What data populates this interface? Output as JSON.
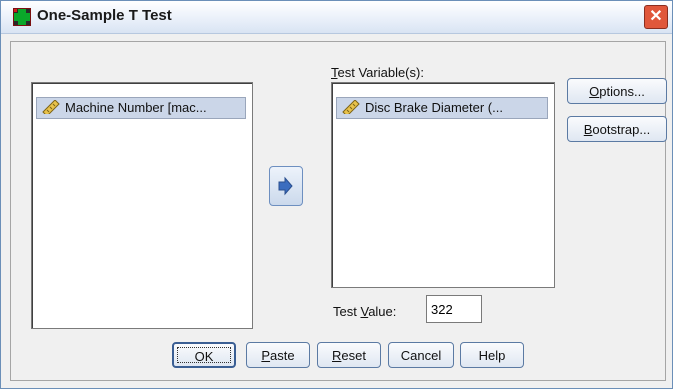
{
  "window": {
    "title": "One-Sample T Test",
    "close_glyph": "✕"
  },
  "source_list": {
    "items": [
      {
        "label": "Machine Number [mac...",
        "icon": "ruler-icon"
      }
    ]
  },
  "move_button": {
    "icon": "arrow-right-icon"
  },
  "test_variables": {
    "label_prefix": "",
    "label_mnemonic": "T",
    "label_rest": "est Variable(s):",
    "items": [
      {
        "label": "Disc Brake Diameter (...",
        "icon": "ruler-icon"
      }
    ]
  },
  "side_buttons": {
    "options": {
      "mnemonic": "O",
      "rest": "ptions..."
    },
    "bootstrap": {
      "mnemonic": "B",
      "rest": "ootstrap..."
    }
  },
  "test_value": {
    "label_prefix": "Test ",
    "label_mnemonic": "V",
    "label_rest": "alue:",
    "value": "322"
  },
  "footer": {
    "ok": "OK",
    "paste": {
      "mnemonic": "P",
      "rest": "aste"
    },
    "reset": {
      "mnemonic": "R",
      "rest": "eset"
    },
    "cancel": "Cancel",
    "help": "Help"
  },
  "colors": {
    "selection": "#cbd6e8",
    "arrow": "#3b6dbf",
    "close": "#e0573b"
  }
}
